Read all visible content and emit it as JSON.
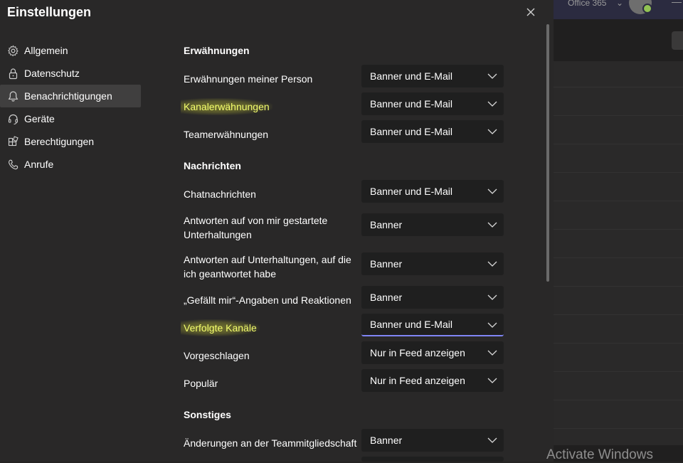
{
  "background_app": {
    "topbar_label": "Office 365",
    "watermark": "Activate Windows"
  },
  "dialog": {
    "title": "Einstellungen",
    "close_icon": "close-icon"
  },
  "nav": {
    "items": [
      {
        "label": "Allgemein",
        "icon": "gear-icon"
      },
      {
        "label": "Datenschutz",
        "icon": "lock-icon"
      },
      {
        "label": "Benachrichtigungen",
        "icon": "bell-icon",
        "active": true
      },
      {
        "label": "Geräte",
        "icon": "headset-icon"
      },
      {
        "label": "Berechtigungen",
        "icon": "apps-icon"
      },
      {
        "label": "Anrufe",
        "icon": "phone-icon"
      }
    ]
  },
  "sections": {
    "mentions": "Erwähnungen",
    "messages": "Nachrichten",
    "other": "Sonstiges"
  },
  "settings": [
    {
      "label": "Erwähnungen meiner Person",
      "value": "Banner und E-Mail"
    },
    {
      "label": "Kanalerwähnungen",
      "value": "Banner und E-Mail",
      "highlighted": true
    },
    {
      "label": "Teamerwähnungen",
      "value": "Banner und E-Mail"
    },
    {
      "label": "Chatnachrichten",
      "value": "Banner und E-Mail"
    },
    {
      "label": "Antworten auf von mir gestartete Unterhaltungen",
      "value": "Banner"
    },
    {
      "label": "Antworten auf Unterhaltungen, auf die ich geantwortet habe",
      "value": "Banner"
    },
    {
      "label": "„Gefällt mir“-Angaben und Reaktionen",
      "value": "Banner"
    },
    {
      "label": "Verfolgte Kanäle",
      "value": "Banner und E-Mail",
      "highlighted": true,
      "focused": true
    },
    {
      "label": "Vorgeschlagen",
      "value": "Nur in Feed anzeigen"
    },
    {
      "label": "Populär",
      "value": "Nur in Feed anzeigen"
    },
    {
      "label": "Änderungen an der Teammitgliedschaft",
      "value": "Banner"
    }
  ],
  "colors": {
    "highlight": "#f5ff6e",
    "focus_underline": "#7f85f5",
    "dialog_bg": "#292828"
  }
}
